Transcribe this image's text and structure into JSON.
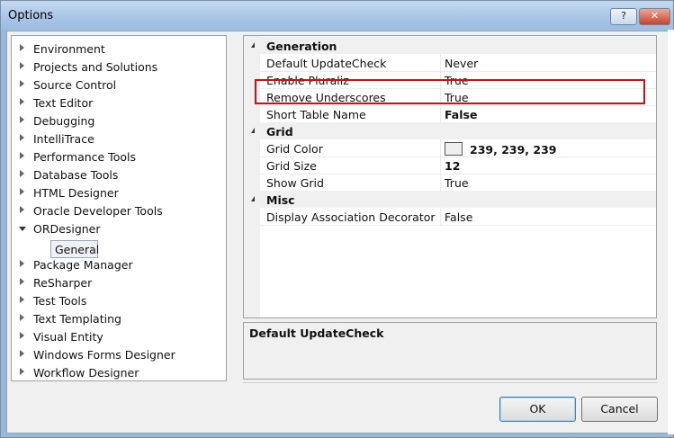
{
  "window": {
    "title": "Options",
    "help_label": "?",
    "close_label": "✕"
  },
  "tree": {
    "items": [
      "Environment",
      "Projects and Solutions",
      "Source Control",
      "Text Editor",
      "Debugging",
      "IntelliTrace",
      "Performance Tools",
      "Database Tools",
      "HTML Designer",
      "Oracle Developer Tools",
      "ORDesigner",
      "Package Manager",
      "ReSharper",
      "Test Tools",
      "Text Templating",
      "Visual Entity",
      "Windows Forms Designer",
      "Workflow Designer"
    ],
    "selected_child": "General"
  },
  "grid": {
    "categories": [
      {
        "label": "Generation"
      },
      {
        "label": "Grid"
      },
      {
        "label": "Misc"
      }
    ],
    "rows": [
      {
        "name": "Default UpdateCheck",
        "value": "Never"
      },
      {
        "name": "Enable Pluraliz",
        "value": "True"
      },
      {
        "name": "Remove Underscores",
        "value": "True"
      },
      {
        "name": "Short Table Name",
        "value": "False"
      },
      {
        "name": "Grid Color",
        "value": "239, 239, 239"
      },
      {
        "name": "Grid Size",
        "value": "12"
      },
      {
        "name": "Show Grid",
        "value": "True"
      },
      {
        "name": "Display Association Decorator Te",
        "value": "False"
      }
    ]
  },
  "description": {
    "title": "Default UpdateCheck"
  },
  "buttons": {
    "ok": "OK",
    "cancel": "Cancel"
  },
  "colors": {
    "highlight": "#d01010",
    "grid_swatch": "#efefef"
  }
}
